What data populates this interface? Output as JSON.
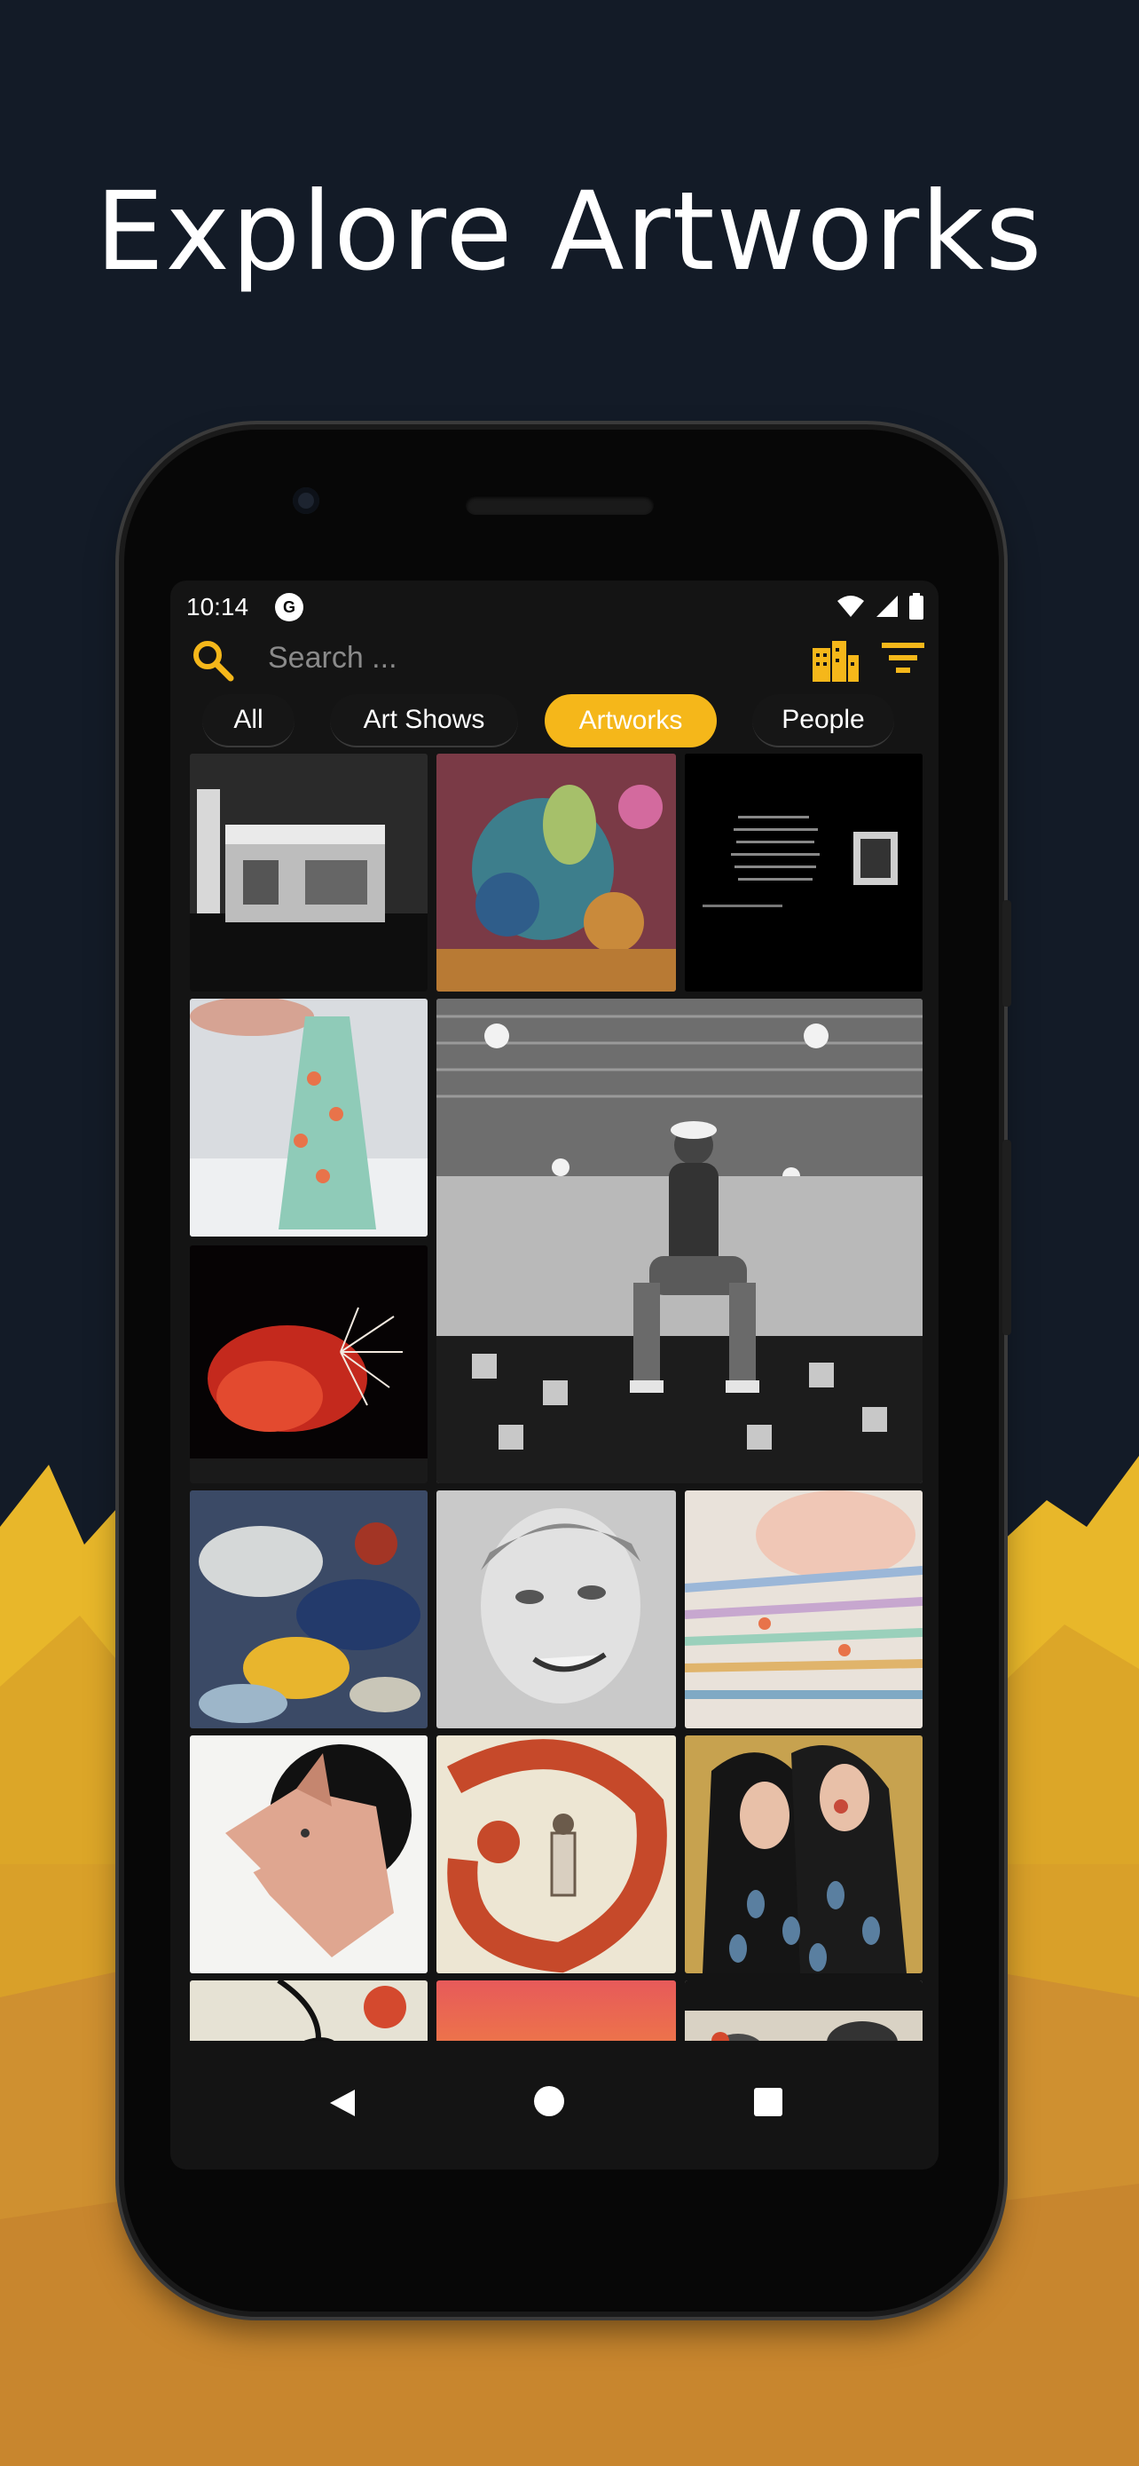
{
  "headline": "Explore Artworks",
  "colors": {
    "background": "#131b27",
    "accent": "#f5b71a",
    "mountain_light": "#e8b72a",
    "mountain_dark": "#c8862e"
  },
  "statusbar": {
    "time": "10:14",
    "app_icon_glyph": "G",
    "icons": [
      "wifi-icon",
      "cell-signal-icon",
      "battery-icon"
    ]
  },
  "search": {
    "placeholder": "Search ...",
    "icons": [
      "search-icon",
      "map-city-icon",
      "filter-icon"
    ]
  },
  "tabs": [
    {
      "label": "All",
      "active": false
    },
    {
      "label": "Art Shows",
      "active": false
    },
    {
      "label": "Artworks",
      "active": true
    },
    {
      "label": "People",
      "active": false
    }
  ],
  "grid": {
    "tiles": [
      "photo-domo-building",
      "painting-colorful-plants",
      "text-document-artwork",
      "beaded-earring",
      "photo-woman-sitting-ceiling",
      "photo-red-fireworks",
      "abstract-painting",
      "pencil-portrait",
      "beaded-bracelets",
      "wolf-drawing",
      "red-swirl-figure",
      "two-women-illustration",
      "face-illustration",
      "sunset-photo",
      "birds-illustration"
    ]
  },
  "navbar": {
    "icons": [
      "back-icon",
      "home-icon",
      "recents-icon"
    ]
  }
}
